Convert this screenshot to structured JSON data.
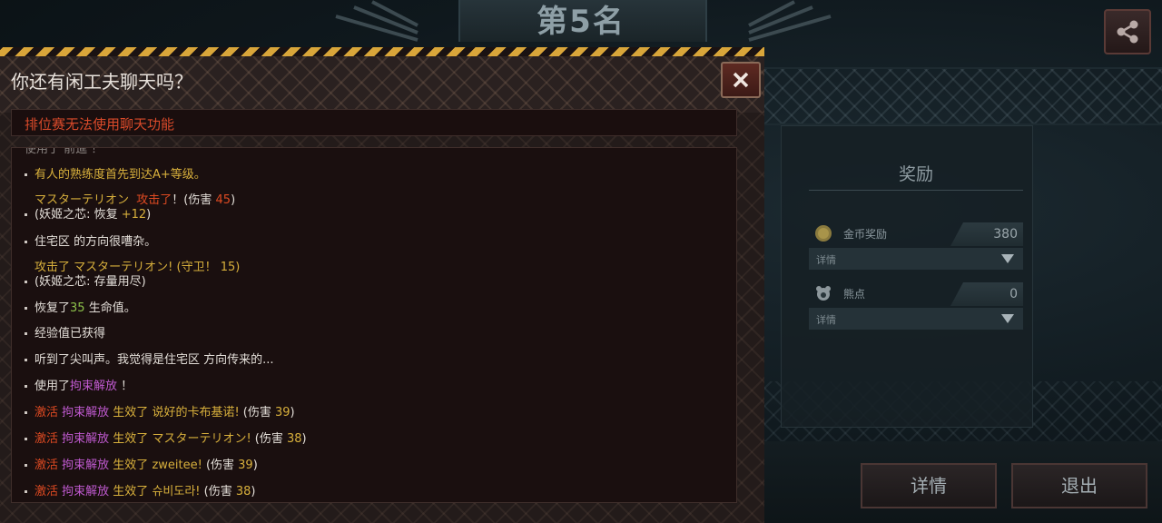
{
  "rank": {
    "title": "第5名"
  },
  "dialog": {
    "title": "你还有闲工夫聊天吗？",
    "notice": "排位赛无法使用聊天功能"
  },
  "chat": {
    "partial_top": "使用了 前進 ！",
    "line1": "有人的熟练度首先到达A+等级。",
    "line2": {
      "name": "マスターテリオン",
      "action": "攻击了",
      "mid": "！(伤害 ",
      "dmg": "45",
      "end": ")"
    },
    "line2b": {
      "pre": "(妖姬之芯: 恢复 ",
      "val": "+12",
      "end": ")"
    },
    "line3": "住宅区 的方向很嘈杂。",
    "line4": {
      "action": "攻击了",
      "rest": " マスターテリオン! (守卫！ 15)"
    },
    "line4b": "(妖姬之芯: 存量用尽)",
    "line5": {
      "pre": "恢复了",
      "val": "35",
      "end": " 生命值。"
    },
    "line6": "经验值已获得",
    "line7": "听到了尖叫声。我觉得是住宅区 方向传来的...",
    "line8": {
      "pre": "使用了",
      "skill": "拘束解放",
      "end": " ！"
    },
    "activations": [
      {
        "act": "激活",
        "skill": "拘束解放",
        "mid": " 生效了 ",
        "target": "说好的卡布基诺!",
        "dmg_label": " (伤害 ",
        "dmg": "39",
        "end": ")"
      },
      {
        "act": "激活",
        "skill": "拘束解放",
        "mid": " 生效了 ",
        "target": "マスターテリオン!",
        "dmg_label": " (伤害 ",
        "dmg": "38",
        "end": ")"
      },
      {
        "act": "激活",
        "skill": "拘束解放",
        "mid": " 生效了 ",
        "target": "zweitee!",
        "dmg_label": " (伤害 ",
        "dmg": "39",
        "end": ")"
      },
      {
        "act": "激活",
        "skill": "拘束解放",
        "mid": " 生效了 ",
        "target": "슈비도라!",
        "dmg_label": " (伤害 ",
        "dmg": "38",
        "end": ")"
      }
    ]
  },
  "reward": {
    "title": "奖励",
    "gold": {
      "label": "金币奖励",
      "value": "380",
      "detail": "详情"
    },
    "points": {
      "label": "熊点",
      "value": "0",
      "detail": "详情"
    }
  },
  "buttons": {
    "detail": "详情",
    "exit": "退出"
  },
  "colors": {
    "gold": "#d8b03c",
    "red": "#de4a22",
    "purple": "#c05ad0",
    "green": "#8cc04a"
  }
}
